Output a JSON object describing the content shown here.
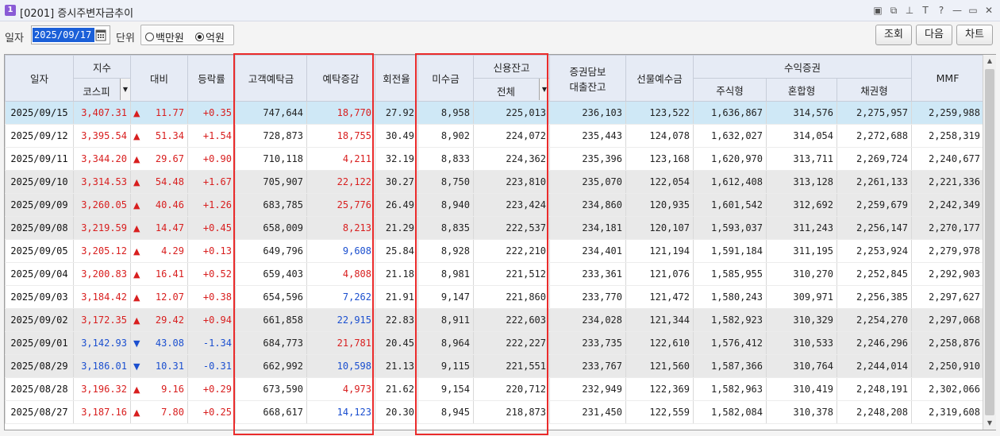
{
  "window": {
    "number": "1",
    "title": "[0201] 증시주변자금추이"
  },
  "title_icons": [
    "▣",
    "⧉",
    "⊥",
    "T",
    "?",
    "—",
    "▭",
    "✕"
  ],
  "toolbar": {
    "date_label": "일자",
    "date_value": "2025/09/17",
    "unit_label": "단위",
    "unit_options": [
      "백만원",
      "억원"
    ],
    "unit_selected": "억원",
    "btn_query": "조회",
    "btn_next": "다음",
    "btn_chart": "차트"
  },
  "headers": {
    "date": "일자",
    "index": "지수",
    "index_select": "코스피",
    "change": "대비",
    "rate": "등락률",
    "deposit": "고객예탁금",
    "deposit_change": "예탁증감",
    "turnover": "회전율",
    "receivable": "미수금",
    "credit": "신용잔고",
    "credit_select": "전체",
    "loan_l1": "증권담보",
    "loan_l2": "대출잔고",
    "futures": "선물예수금",
    "fund": "수익증권",
    "stock": "주식형",
    "mixed": "혼합형",
    "bond": "채권형",
    "mmf": "MMF"
  },
  "rows": [
    {
      "date": "2025/09/15",
      "index": "3,407.31",
      "dir": "up",
      "change": "11.77",
      "rate": "+0.35",
      "deposit": "747,644",
      "dchg": "18,770",
      "ddir": "up",
      "turn": "27.92",
      "recv": "8,958",
      "credit": "225,013",
      "loan": "236,103",
      "fut": "123,522",
      "stock": "1,636,867",
      "mixed": "314,576",
      "bond": "2,275,957",
      "mmf": "2,259,988"
    },
    {
      "date": "2025/09/12",
      "index": "3,395.54",
      "dir": "up",
      "change": "51.34",
      "rate": "+1.54",
      "deposit": "728,873",
      "dchg": "18,755",
      "ddir": "up",
      "turn": "30.49",
      "recv": "8,902",
      "credit": "224,072",
      "loan": "235,443",
      "fut": "124,078",
      "stock": "1,632,027",
      "mixed": "314,054",
      "bond": "2,272,688",
      "mmf": "2,258,319"
    },
    {
      "date": "2025/09/11",
      "index": "3,344.20",
      "dir": "up",
      "change": "29.67",
      "rate": "+0.90",
      "deposit": "710,118",
      "dchg": "4,211",
      "ddir": "up",
      "turn": "32.19",
      "recv": "8,833",
      "credit": "224,362",
      "loan": "235,396",
      "fut": "123,168",
      "stock": "1,620,970",
      "mixed": "313,711",
      "bond": "2,269,724",
      "mmf": "2,240,677"
    },
    {
      "date": "2025/09/10",
      "index": "3,314.53",
      "dir": "up",
      "change": "54.48",
      "rate": "+1.67",
      "deposit": "705,907",
      "dchg": "22,122",
      "ddir": "up",
      "turn": "30.27",
      "recv": "8,750",
      "credit": "223,810",
      "loan": "235,070",
      "fut": "122,054",
      "stock": "1,612,408",
      "mixed": "313,128",
      "bond": "2,261,133",
      "mmf": "2,221,336"
    },
    {
      "date": "2025/09/09",
      "index": "3,260.05",
      "dir": "up",
      "change": "40.46",
      "rate": "+1.26",
      "deposit": "683,785",
      "dchg": "25,776",
      "ddir": "up",
      "turn": "26.49",
      "recv": "8,940",
      "credit": "223,424",
      "loan": "234,860",
      "fut": "120,935",
      "stock": "1,601,542",
      "mixed": "312,692",
      "bond": "2,259,679",
      "mmf": "2,242,349"
    },
    {
      "date": "2025/09/08",
      "index": "3,219.59",
      "dir": "up",
      "change": "14.47",
      "rate": "+0.45",
      "deposit": "658,009",
      "dchg": "8,213",
      "ddir": "up",
      "turn": "21.29",
      "recv": "8,835",
      "credit": "222,537",
      "loan": "234,181",
      "fut": "120,107",
      "stock": "1,593,037",
      "mixed": "311,243",
      "bond": "2,256,147",
      "mmf": "2,270,177"
    },
    {
      "date": "2025/09/05",
      "index": "3,205.12",
      "dir": "up",
      "change": "4.29",
      "rate": "+0.13",
      "deposit": "649,796",
      "dchg": "9,608",
      "ddir": "down",
      "turn": "25.84",
      "recv": "8,928",
      "credit": "222,210",
      "loan": "234,401",
      "fut": "121,194",
      "stock": "1,591,184",
      "mixed": "311,195",
      "bond": "2,253,924",
      "mmf": "2,279,978"
    },
    {
      "date": "2025/09/04",
      "index": "3,200.83",
      "dir": "up",
      "change": "16.41",
      "rate": "+0.52",
      "deposit": "659,403",
      "dchg": "4,808",
      "ddir": "up",
      "turn": "21.18",
      "recv": "8,981",
      "credit": "221,512",
      "loan": "233,361",
      "fut": "121,076",
      "stock": "1,585,955",
      "mixed": "310,270",
      "bond": "2,252,845",
      "mmf": "2,292,903"
    },
    {
      "date": "2025/09/03",
      "index": "3,184.42",
      "dir": "up",
      "change": "12.07",
      "rate": "+0.38",
      "deposit": "654,596",
      "dchg": "7,262",
      "ddir": "down",
      "turn": "21.91",
      "recv": "9,147",
      "credit": "221,860",
      "loan": "233,770",
      "fut": "121,472",
      "stock": "1,580,243",
      "mixed": "309,971",
      "bond": "2,256,385",
      "mmf": "2,297,627"
    },
    {
      "date": "2025/09/02",
      "index": "3,172.35",
      "dir": "up",
      "change": "29.42",
      "rate": "+0.94",
      "deposit": "661,858",
      "dchg": "22,915",
      "ddir": "down",
      "turn": "22.83",
      "recv": "8,911",
      "credit": "222,603",
      "loan": "234,028",
      "fut": "121,344",
      "stock": "1,582,923",
      "mixed": "310,329",
      "bond": "2,254,270",
      "mmf": "2,297,068"
    },
    {
      "date": "2025/09/01",
      "index": "3,142.93",
      "dir": "down",
      "change": "43.08",
      "rate": "-1.34",
      "deposit": "684,773",
      "dchg": "21,781",
      "ddir": "up",
      "turn": "20.45",
      "recv": "8,964",
      "credit": "222,227",
      "loan": "233,735",
      "fut": "122,610",
      "stock": "1,576,412",
      "mixed": "310,533",
      "bond": "2,246,296",
      "mmf": "2,258,876"
    },
    {
      "date": "2025/08/29",
      "index": "3,186.01",
      "dir": "down",
      "change": "10.31",
      "rate": "-0.31",
      "deposit": "662,992",
      "dchg": "10,598",
      "ddir": "down",
      "turn": "21.13",
      "recv": "9,115",
      "credit": "221,551",
      "loan": "233,767",
      "fut": "121,560",
      "stock": "1,587,366",
      "mixed": "310,764",
      "bond": "2,244,014",
      "mmf": "2,250,910"
    },
    {
      "date": "2025/08/28",
      "index": "3,196.32",
      "dir": "up",
      "change": "9.16",
      "rate": "+0.29",
      "deposit": "673,590",
      "dchg": "4,973",
      "ddir": "up",
      "turn": "21.62",
      "recv": "9,154",
      "credit": "220,712",
      "loan": "232,949",
      "fut": "122,369",
      "stock": "1,582,963",
      "mixed": "310,419",
      "bond": "2,248,191",
      "mmf": "2,302,066"
    },
    {
      "date": "2025/08/27",
      "index": "3,187.16",
      "dir": "up",
      "change": "7.80",
      "rate": "+0.25",
      "deposit": "668,617",
      "dchg": "14,123",
      "ddir": "down",
      "turn": "20.30",
      "recv": "8,945",
      "credit": "218,873",
      "loan": "231,450",
      "fut": "122,559",
      "stock": "1,582,084",
      "mixed": "310,378",
      "bond": "2,248,208",
      "mmf": "2,319,608"
    }
  ],
  "row_styles": [
    "sel",
    "",
    "",
    "gray",
    "gray",
    "gray",
    "",
    "",
    "",
    "gray",
    "gray",
    "gray",
    "",
    ""
  ],
  "colors": {
    "up": "#d81e1e",
    "down": "#1b4fcf",
    "selected_row": "#cfe8f6",
    "highlight_box": "#ea2b2b",
    "header_bg": "#e6ebf5"
  },
  "arrows": {
    "up": "▲",
    "down": "▼"
  }
}
